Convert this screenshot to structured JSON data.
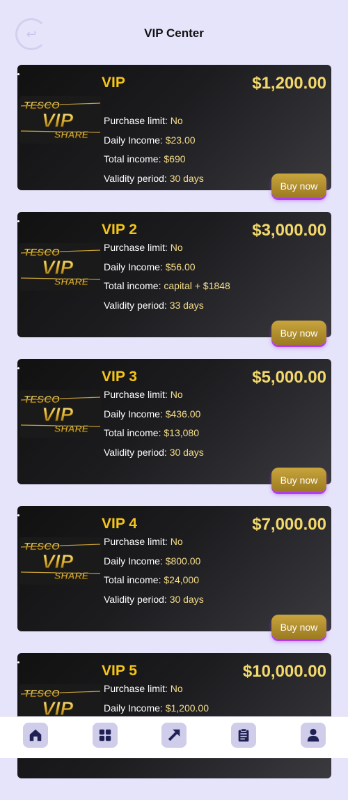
{
  "header": {
    "title": "VIP Center"
  },
  "labels": {
    "purchase_limit": "Purchase limit: ",
    "daily_income": "Daily Income: ",
    "total_income": "Total income: ",
    "validity": "Validity period: ",
    "buy": "Buy now",
    "logo_text_1": "TESCO",
    "logo_text_2": "VIP",
    "logo_text_3": "SHARE"
  },
  "plans": [
    {
      "name": "VIP",
      "price": "$1,200.00",
      "purchase_limit": "No",
      "daily_income": "$23.00",
      "total_income": "$690",
      "validity": "30 days"
    },
    {
      "name": "VIP 2",
      "price": "$3,000.00",
      "purchase_limit": "No",
      "daily_income": "$56.00",
      "total_income": "capital + $1848",
      "validity": "33 days"
    },
    {
      "name": "VIP 3",
      "price": "$5,000.00",
      "purchase_limit": "No",
      "daily_income": "$436.00",
      "total_income": "$13,080",
      "validity": "30 days"
    },
    {
      "name": "VIP 4",
      "price": "$7,000.00",
      "purchase_limit": "No",
      "daily_income": "$800.00",
      "total_income": "$24,000",
      "validity": "30 days"
    },
    {
      "name": "VIP 5",
      "price": "$10,000.00",
      "purchase_limit": "No",
      "daily_income": "$1,200.00"
    }
  ],
  "nav": [
    {
      "icon": "home-icon"
    },
    {
      "icon": "grid-icon"
    },
    {
      "icon": "share-arrow-icon"
    },
    {
      "icon": "clipboard-icon"
    },
    {
      "icon": "user-icon"
    }
  ]
}
